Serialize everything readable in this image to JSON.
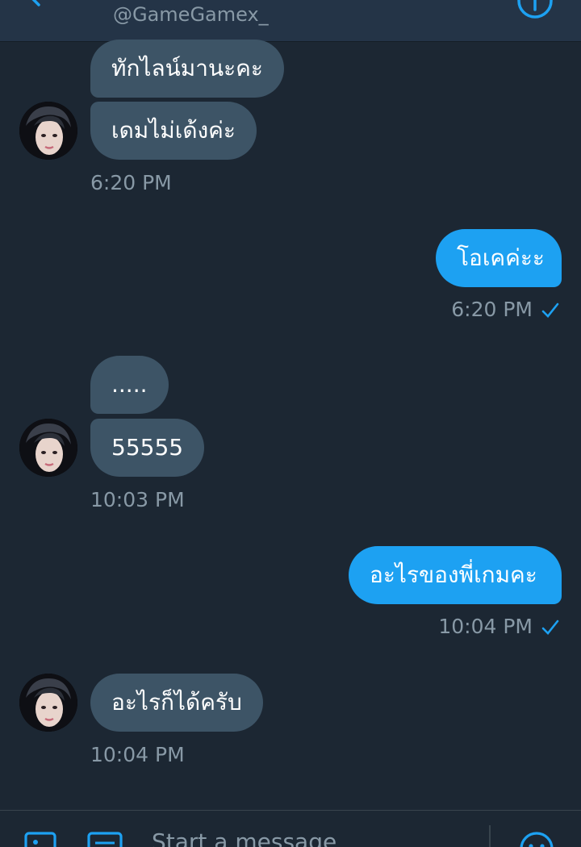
{
  "header": {
    "handle": "@GameGamex_",
    "back_icon": "back-arrow-icon",
    "info_icon": "info-icon"
  },
  "colors": {
    "background": "#1c2733",
    "header": "#243447",
    "received_bubble": "#3d5466",
    "sent_bubble": "#1da1f2",
    "muted_text": "#8899a6"
  },
  "conversation": {
    "group1": {
      "messages": [
        "ทักไลน์มานะคะ",
        "เดมไม่เด้งค่ะ"
      ],
      "time": "6:20 PM"
    },
    "group2": {
      "messages": [
        "โอเคค่ะะ"
      ],
      "time": "6:20 PM"
    },
    "group3": {
      "messages": [
        ".....",
        "55555"
      ],
      "time": "10:03 PM"
    },
    "group4": {
      "messages": [
        "อะไรของพี่เกมคะ"
      ],
      "time": "10:04 PM"
    },
    "group5": {
      "messages": [
        "อะไรก็ได้ครับ"
      ],
      "time": "10:04 PM"
    }
  },
  "composer": {
    "placeholder": "Start a message",
    "icons": [
      "image-icon",
      "gif-icon",
      "emoji-icon"
    ]
  }
}
